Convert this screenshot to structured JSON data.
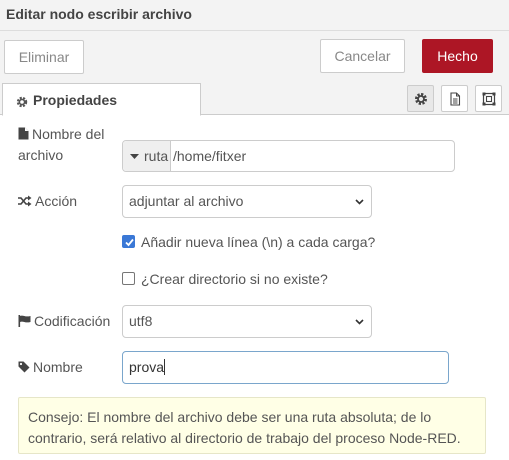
{
  "dialog": {
    "title": "Editar nodo escribir archivo"
  },
  "toolbar": {
    "delete_label": "Eliminar",
    "cancel_label": "Cancelar",
    "done_label": "Hecho"
  },
  "tabs": {
    "properties_label": "Propiedades"
  },
  "form": {
    "filename": {
      "label_line1": "Nombre del",
      "label_line2": "archivo",
      "type_label": "ruta",
      "value": "/home/fitxer"
    },
    "action": {
      "label": "Acción",
      "selected": "adjuntar al archivo"
    },
    "append_newline": {
      "label": "Añadir nueva línea (\\n) a cada carga?",
      "checked": true
    },
    "create_dir": {
      "label": "¿Crear directorio si no existe?",
      "checked": false
    },
    "encoding": {
      "label": "Codificación",
      "selected": "utf8"
    },
    "name": {
      "label": "Nombre",
      "value": "prova"
    }
  },
  "tip": {
    "text": "Consejo: El nombre del archivo debe ser una ruta absoluta; de lo contrario, será relativo al directorio de trabajo del proceso Node-RED."
  },
  "colors": {
    "primary": "#ad1625",
    "tip_background": "#ffffe6",
    "checkbox": "#3a78d6"
  }
}
